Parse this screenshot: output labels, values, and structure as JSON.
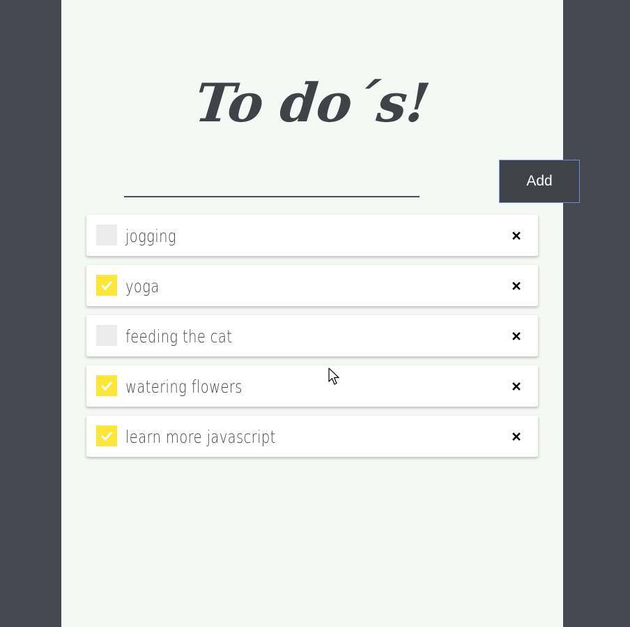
{
  "app": {
    "title": "To do´s!"
  },
  "form": {
    "input_value": "",
    "input_placeholder": "",
    "add_label": "Add"
  },
  "todos": [
    {
      "text": "jogging",
      "done": false
    },
    {
      "text": "yoga",
      "done": true
    },
    {
      "text": "feeding the cat",
      "done": false
    },
    {
      "text": "watering flowers",
      "done": true
    },
    {
      "text": "learn more javascript",
      "done": true
    }
  ],
  "colors": {
    "background": "#464a50",
    "panel": "#f6f8f5",
    "accent_checked": "#fde53a",
    "unchecked": "#ececec",
    "button": "#3f4348",
    "button_border": "#6e8fd8"
  },
  "icons": {
    "check": "check-icon",
    "delete": "close-icon",
    "cursor": "mouse-pointer-icon"
  }
}
